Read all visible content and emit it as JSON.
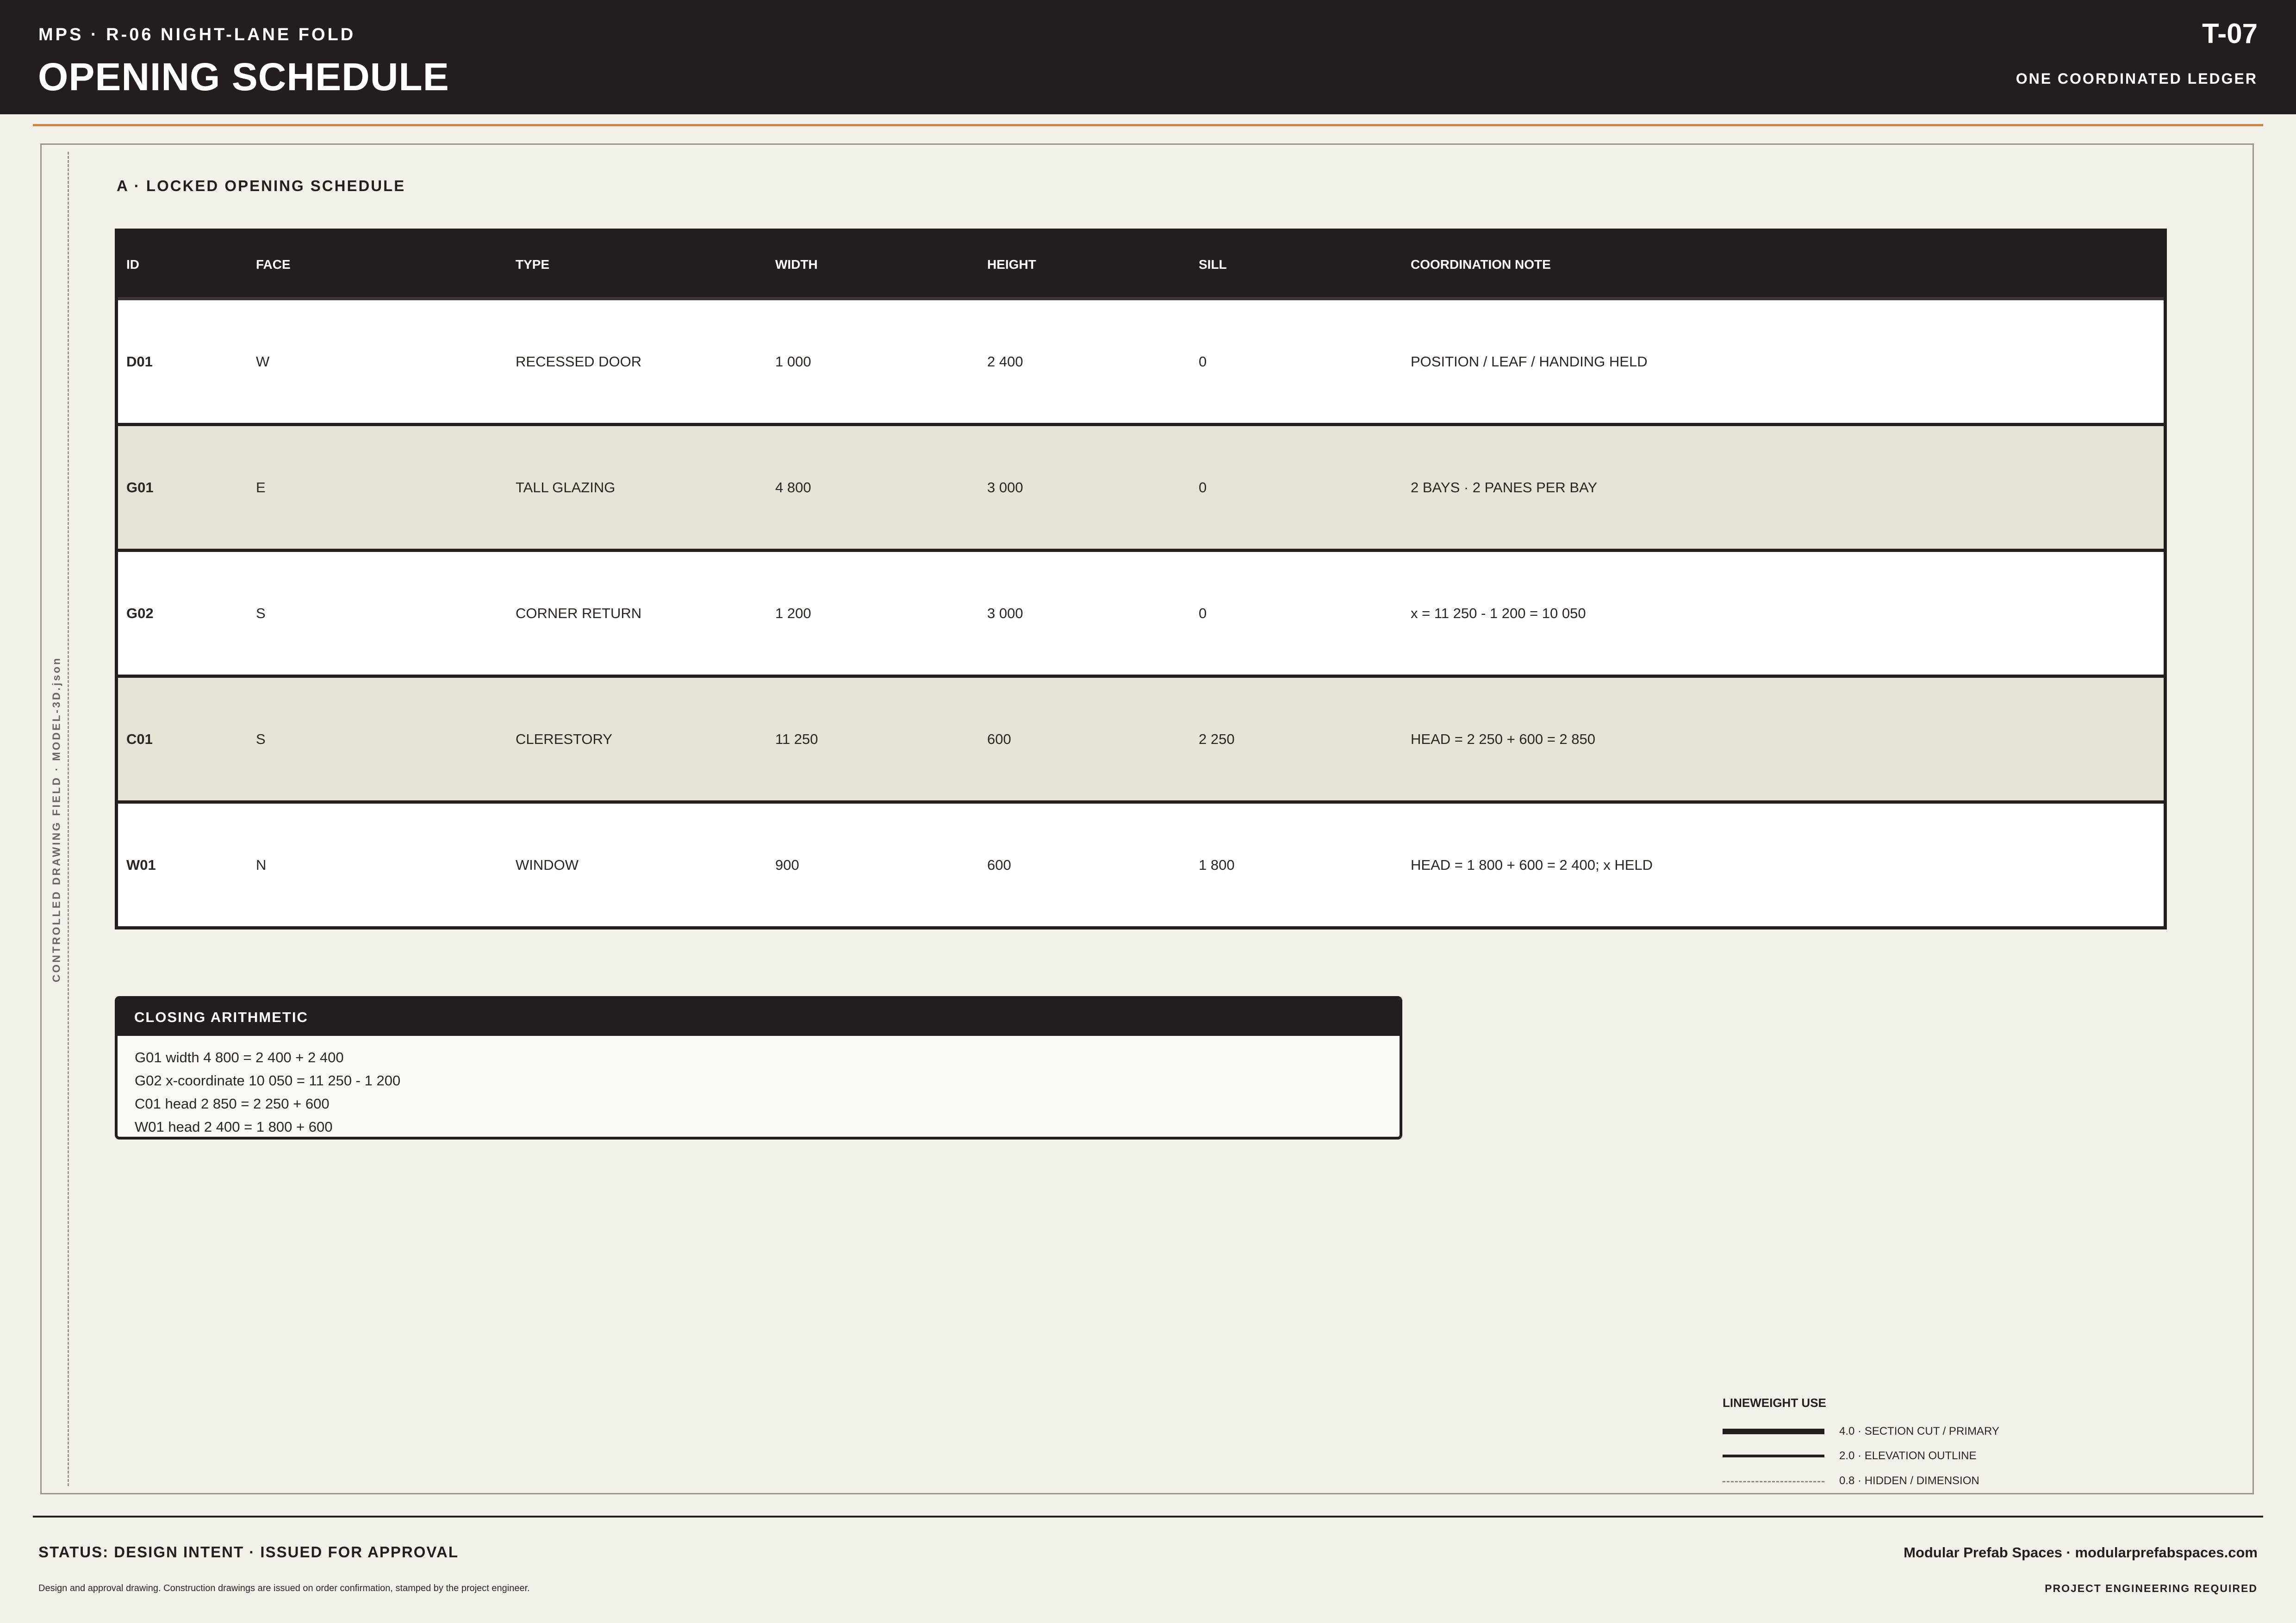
{
  "header": {
    "project": "MPS · R-06 NIGHT-LANE FOLD",
    "title": "OPENING SCHEDULE",
    "sheet_no": "T-07",
    "ledger": "ONE COORDINATED LEDGER"
  },
  "field": {
    "side_label": "CONTROLLED DRAWING FIELD · MODEL-3D.json"
  },
  "section": {
    "title": "A · LOCKED OPENING SCHEDULE"
  },
  "schedule": {
    "columns": [
      "ID",
      "FACE",
      "TYPE",
      "WIDTH",
      "HEIGHT",
      "SILL",
      "COORDINATION NOTE"
    ],
    "rows": [
      {
        "id": "D01",
        "face": "W",
        "type": "RECESSED DOOR",
        "width": "1 000",
        "height": "2 400",
        "sill": "0",
        "note": "POSITION / LEAF / HANDING HELD"
      },
      {
        "id": "G01",
        "face": "E",
        "type": "TALL GLAZING",
        "width": "4 800",
        "height": "3 000",
        "sill": "0",
        "note": "2 BAYS · 2 PANES PER BAY"
      },
      {
        "id": "G02",
        "face": "S",
        "type": "CORNER RETURN",
        "width": "1 200",
        "height": "3 000",
        "sill": "0",
        "note": "x = 11 250 - 1 200 = 10 050"
      },
      {
        "id": "C01",
        "face": "S",
        "type": "CLERESTORY",
        "width": "11 250",
        "height": "600",
        "sill": "2 250",
        "note": "HEAD = 2 250 + 600 = 2 850"
      },
      {
        "id": "W01",
        "face": "N",
        "type": "WINDOW",
        "width": "900",
        "height": "600",
        "sill": "1 800",
        "note": "HEAD = 1 800 + 600 = 2 400; x HELD"
      }
    ]
  },
  "arithmetic": {
    "title": "CLOSING ARITHMETIC",
    "lines": [
      "G01 width 4 800 = 2 400 + 2 400",
      "G02 x-coordinate 10 050 = 11 250 - 1 200",
      "C01 head 2 850 = 2 250 + 600",
      "W01 head 2 400 = 1 800 + 600"
    ]
  },
  "lineweights": {
    "title": "LINEWEIGHT USE",
    "items": [
      {
        "label": "4.0 · SECTION CUT / PRIMARY"
      },
      {
        "label": "2.0 · ELEVATION OUTLINE"
      },
      {
        "label": "0.8 · HIDDEN / DIMENSION"
      }
    ]
  },
  "footer": {
    "status": "STATUS: DESIGN INTENT · ISSUED FOR APPROVAL",
    "disclaimer": "Design and approval drawing. Construction drawings are issued on order confirmation, stamped by the project engineer.",
    "company": "Modular Prefab Spaces · modularprefabspaces.com",
    "engineering": "PROJECT ENGINEERING REQUIRED"
  },
  "colors": {
    "ink": "#231e1d",
    "paper": "#f4f1ea",
    "accent": "#c6894a",
    "row_alt": "#e7e3d7"
  }
}
